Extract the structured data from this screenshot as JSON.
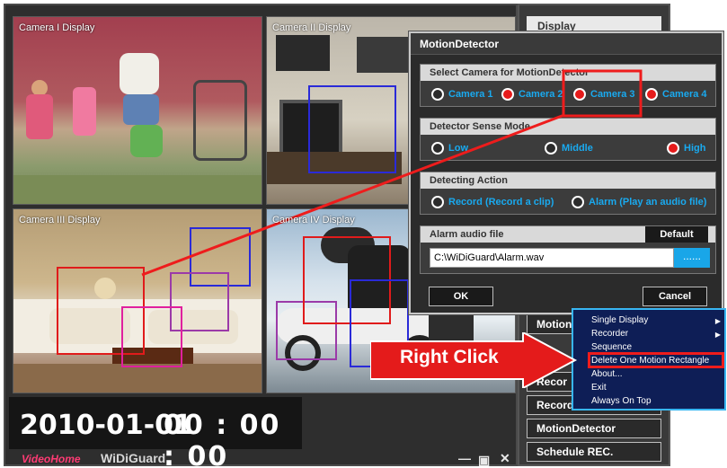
{
  "cameras": [
    {
      "label": "Camera I Display"
    },
    {
      "label": "Camera II Display"
    },
    {
      "label": "Camera III Display"
    },
    {
      "label": "Camera IV Display"
    }
  ],
  "clock": {
    "date": "2010-01-01",
    "time": "00 : 00 : 00"
  },
  "brand": {
    "logo": "VideoHome",
    "product": "WiDiGuard"
  },
  "panel": {
    "display_label": "Display",
    "buttons": [
      "MotionDet",
      "Recor",
      "Record",
      "MotionDetector",
      "Schedule REC."
    ]
  },
  "dialog": {
    "title": "MotionDetector",
    "select_camera": {
      "title": "Select Camera for MotionDetector",
      "options": [
        "Camera 1",
        "Camera 2",
        "Camera 3",
        "Camera 4"
      ],
      "selected": [
        false,
        true,
        true,
        true
      ]
    },
    "sense_mode": {
      "title": "Detector Sense Mode",
      "options": [
        "Low",
        "Middle",
        "High"
      ],
      "selected": "High"
    },
    "action": {
      "title": "Detecting Action",
      "options": [
        "Record (Record a clip)",
        "Alarm (Play an audio file)"
      ]
    },
    "alarm": {
      "title": "Alarm audio file",
      "default_label": "Default",
      "path_value": "C:\\WiDiGuard\\Alarm.wav",
      "browse_label": "......"
    },
    "ok_label": "OK",
    "cancel_label": "Cancel"
  },
  "context_menu": {
    "items": [
      "Single Display",
      "Recorder",
      "Sequence",
      "Delete One Motion Rectangle",
      "About...",
      "Exit",
      "Always On Top"
    ],
    "submenu_items": [
      "Single Display",
      "Recorder"
    ],
    "highlighted": "Delete One Motion Rectangle"
  },
  "annotation": {
    "label": "Right Click"
  },
  "colors": {
    "accent": "#19aaf0",
    "highlight": "#ee1c1c",
    "menu_bg": "#0e1e56"
  }
}
